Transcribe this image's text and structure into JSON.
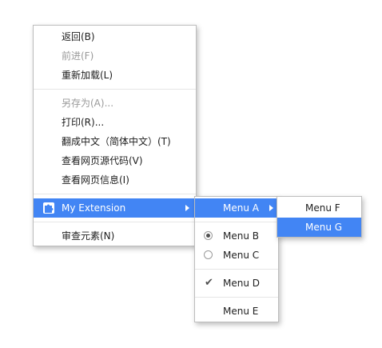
{
  "main_menu": {
    "items": [
      {
        "label": "返回(B)",
        "disabled": false
      },
      {
        "label": "前进(F)",
        "disabled": true
      },
      {
        "label": "重新加载(L)",
        "disabled": false
      },
      {
        "label": "另存为(A)...",
        "disabled": true
      },
      {
        "label": "打印(R)...",
        "disabled": false
      },
      {
        "label": "翻成中文（简体中文）(T)",
        "disabled": false
      },
      {
        "label": "查看网页源代码(V)",
        "disabled": false
      },
      {
        "label": "查看网页信息(I)",
        "disabled": false
      }
    ],
    "extension": {
      "label": "My Extension",
      "icon": "puzzle-piece-icon"
    },
    "inspect": {
      "label": "审查元素(N)"
    }
  },
  "submenu_1": {
    "menu_a": {
      "label": "Menu A"
    },
    "menu_b": {
      "label": "Menu B",
      "radio_checked": true
    },
    "menu_c": {
      "label": "Menu C",
      "radio_checked": false
    },
    "menu_d": {
      "label": "Menu D",
      "checked": true
    },
    "menu_e": {
      "label": "Menu E"
    }
  },
  "submenu_2": {
    "menu_f": {
      "label": "Menu F"
    },
    "menu_g": {
      "label": "Menu G"
    }
  },
  "colors": {
    "highlight": "#4285f4",
    "disabled_text": "#9a9a9a",
    "separator": "#e6e6e6"
  }
}
